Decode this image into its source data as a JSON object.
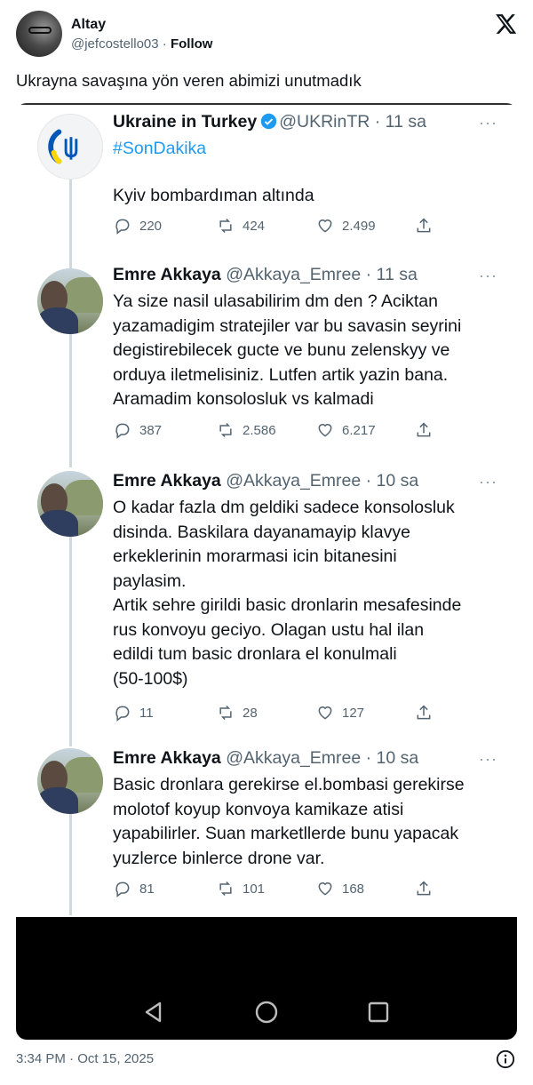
{
  "embed": {
    "author_name": "Altay",
    "author_handle": "@jefcostello03",
    "separator": "·",
    "follow_label": "Follow",
    "post_text": "Ukrayna savaşına yön veren abimizi unutmadık",
    "timestamp": "3:34 PM · Oct 15, 2025"
  },
  "screenshot": {
    "tweets": [
      {
        "name": "Ukraine in Turkey",
        "verified": true,
        "meta": "@UKRinTR · 11 sa",
        "hashtag": "#SonDakika",
        "text": "Kyiv bombardıman altında",
        "replies": "220",
        "retweets": "424",
        "likes": "2.499"
      },
      {
        "name": "Emre Akkaya",
        "meta": "@Akkaya_Emree · 11 sa",
        "text": "Ya size nasil ulasabilirim dm den ? Aciktan\nyazamadigim stratejiler var bu savasin seyrini\ndegistirebilecek gucte ve bunu zelenskyy ve\norduya iletmelisiniz. Lutfen artik yazin bana.\nAramadim konsolosluk vs kalmadi",
        "replies": "387",
        "retweets": "2.586",
        "likes": "6.217"
      },
      {
        "name": "Emre Akkaya",
        "meta": "@Akkaya_Emree · 10 sa",
        "text": "O kadar fazla dm geldiki sadece konsolosluk\ndisinda. Baskilara dayanamayip klavye\nerkeklerinin morarmasi icin bitanesini\npaylasim.\nArtik sehre girildi basic dronlarin mesafesinde\nrus konvoyu geciyo. Olagan ustu hal ilan\nedildi tum basic dronlara el konulmali\n(50-100$)",
        "replies": "11",
        "retweets": "28",
        "likes": "127"
      },
      {
        "name": "Emre Akkaya",
        "meta": "@Akkaya_Emree · 10 sa",
        "text": "Basic dronlara gerekirse el.bombasi gerekirse\nmolotof koyup konvoya kamikaze atisi\nyapabilirler. Suan marketllerde bunu yapacak\nyuzlerce binlerce drone var.",
        "replies": "81",
        "retweets": "101",
        "likes": "168"
      }
    ],
    "more_glyph": "···"
  },
  "icons": {
    "x_logo": "x-logo",
    "reply": "reply-icon",
    "retweet": "retweet-icon",
    "like": "heart-icon",
    "share": "share-icon",
    "nav_back": "back-triangle-icon",
    "nav_home": "home-circle-icon",
    "nav_recent": "recents-square-icon",
    "info": "info-icon"
  },
  "colors": {
    "link_blue": "#1d9bf0",
    "text_primary": "#0f1419",
    "text_secondary": "#536471",
    "navbar": "#000000",
    "ukraine_blue": "#0057b7",
    "ukraine_yellow": "#ffd700"
  }
}
